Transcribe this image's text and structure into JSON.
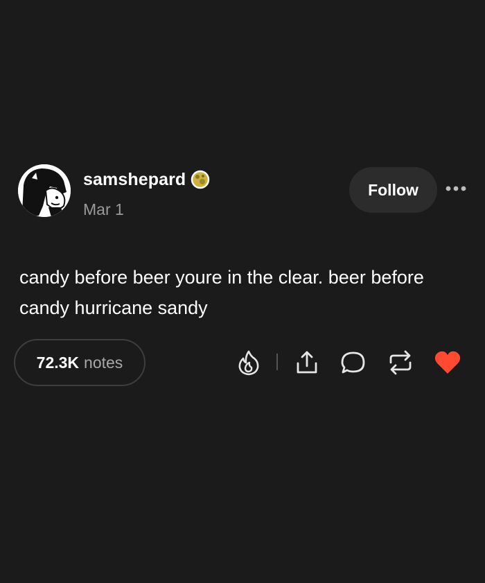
{
  "post": {
    "username": "samshepard",
    "date": "Mar 1",
    "follow_label": "Follow",
    "body": "candy before beer youre in the clear. beer before candy hurricane sandy",
    "notes": {
      "count": "72.3K",
      "label": "notes"
    },
    "actions": {
      "blaze": "fire-icon",
      "share": "share-icon",
      "reply": "comment-icon",
      "reblog": "reblog-icon",
      "like": "heart-icon",
      "like_color": "#ff4930"
    }
  }
}
